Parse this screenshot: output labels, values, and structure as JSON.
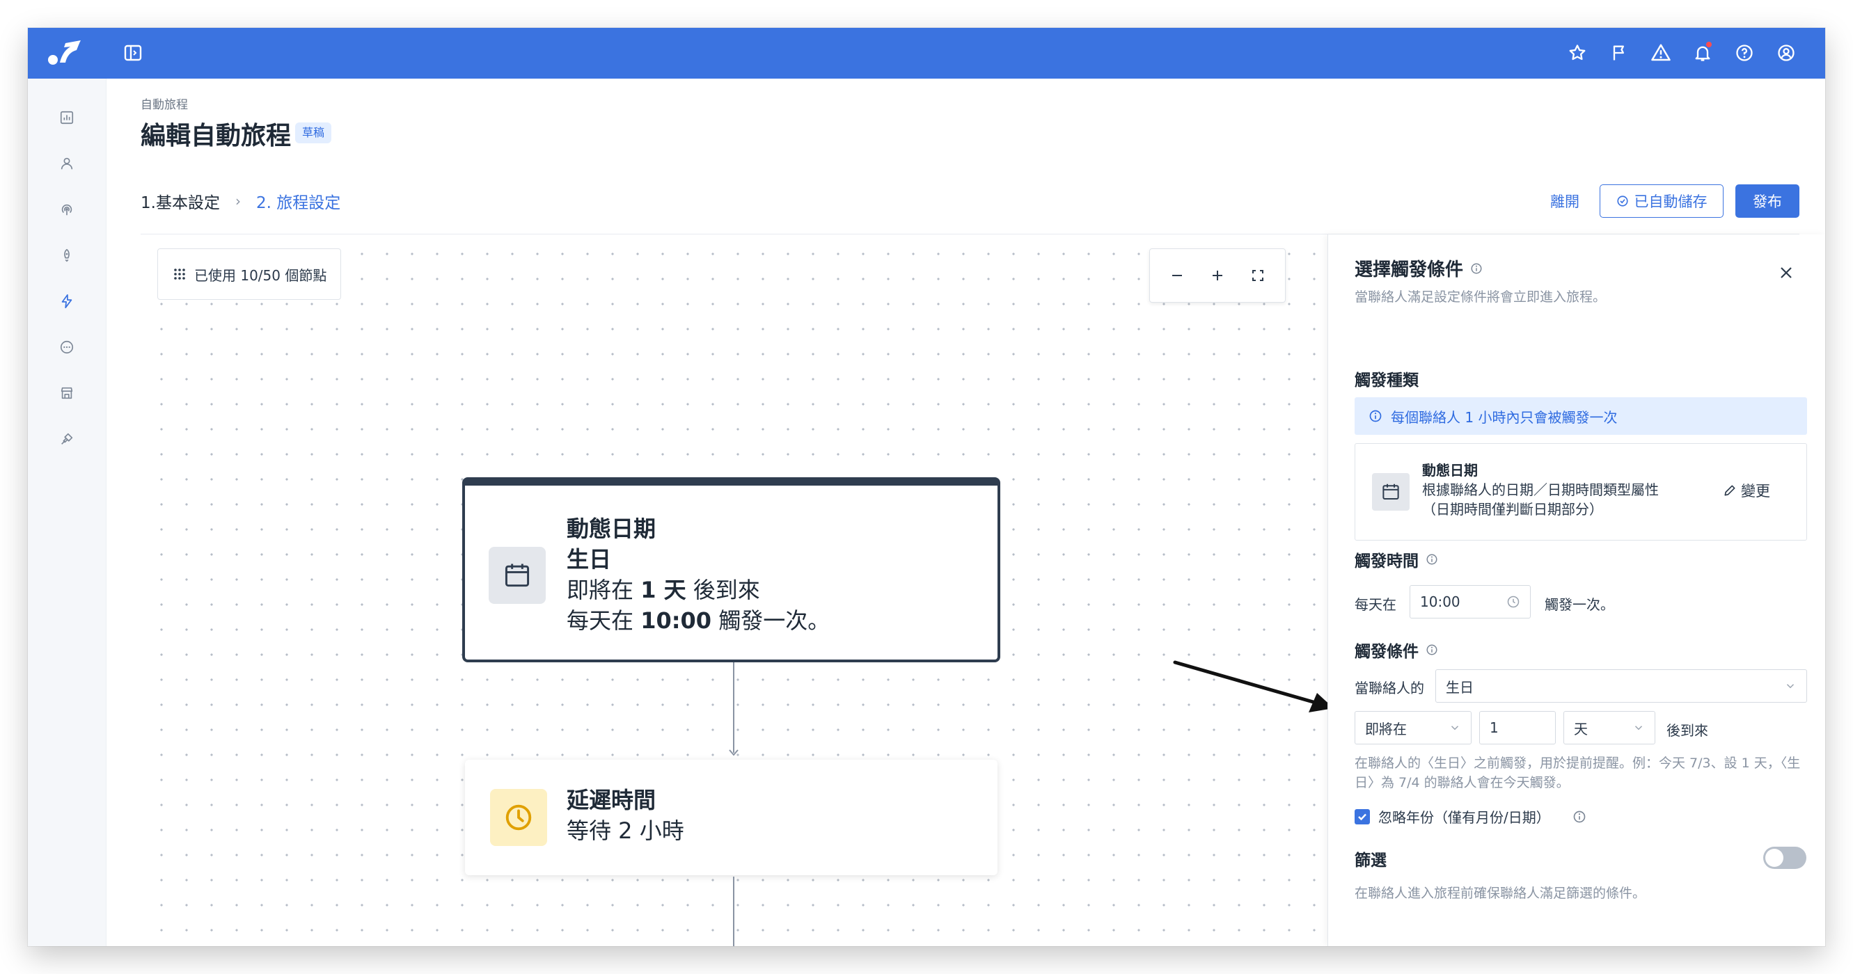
{
  "breadcrumb": "自動旅程",
  "page_title": "編輯自動旅程",
  "status_badge": "草稿",
  "steps": {
    "step1": "1.基本設定",
    "separator": "›",
    "step2": "2. 旅程設定"
  },
  "actions": {
    "leave": "離開",
    "autosave": "已自動儲存",
    "publish": "發布"
  },
  "canvas": {
    "node_count": "已使用 10/50 個節點",
    "trigger_node": {
      "title": "動態日期",
      "field": "生日",
      "line1_pre": "即將在 ",
      "line1_bold": "1 天",
      "line1_post": " 後到來",
      "line2_pre": "每天在 ",
      "line2_bold": "10:00",
      "line2_post": " 觸發一次。"
    },
    "delay_node": {
      "title": "延遲時間",
      "desc": "等待 2 小時"
    }
  },
  "panel": {
    "title": "選擇觸發條件",
    "subtitle": "當聯絡人滿足設定條件將會立即進入旅程。",
    "trigger_type_label": "觸發種類",
    "info_banner": "每個聯絡人 1 小時內只會被觸發一次",
    "trigger_card": {
      "name": "動態日期",
      "desc1": "根據聯絡人的日期／日期時間類型屬性",
      "desc2": "（日期時間僅判斷日期部分）",
      "change": "變更"
    },
    "trigger_time_label": "觸發時間",
    "every_day": "每天在",
    "time_value": "10:00",
    "trigger_once": "觸發一次。",
    "condition_label": "觸發條件",
    "when_contact": "當聯絡人的",
    "attribute": "生日",
    "relation": "即將在",
    "offset": "1",
    "unit": "天",
    "arrives": "後到來",
    "hint": "在聯絡人的〈生日〉之前觸發，用於提前提醒。例：今天 7/3、設 1 天，〈生日〉為 7/4 的聯絡人會在今天觸發。",
    "ignore_year": "忽略年份（僅有月份/日期）",
    "ignore_year_checked": true,
    "filter_label": "篩選",
    "filter_on": false,
    "filter_desc": "在聯絡人進入旅程前確保聯絡人滿足篩選的條件。"
  },
  "colors": {
    "primary": "#3b73e0",
    "topbar": "#3b73e0",
    "node_border": "#2f3d4f",
    "delay_icon_bg": "#fdf0c2",
    "info_bg": "#e3eeff"
  },
  "icons": {
    "topbar": [
      "star-icon",
      "flag-icon",
      "warning-icon",
      "bell-icon",
      "help-icon",
      "user-circle-icon"
    ],
    "rail": [
      "chart-icon",
      "contacts-icon",
      "broadcast-icon",
      "rocket-icon",
      "journey-bolt-icon",
      "chat-icon",
      "store-icon",
      "integration-icon"
    ]
  }
}
